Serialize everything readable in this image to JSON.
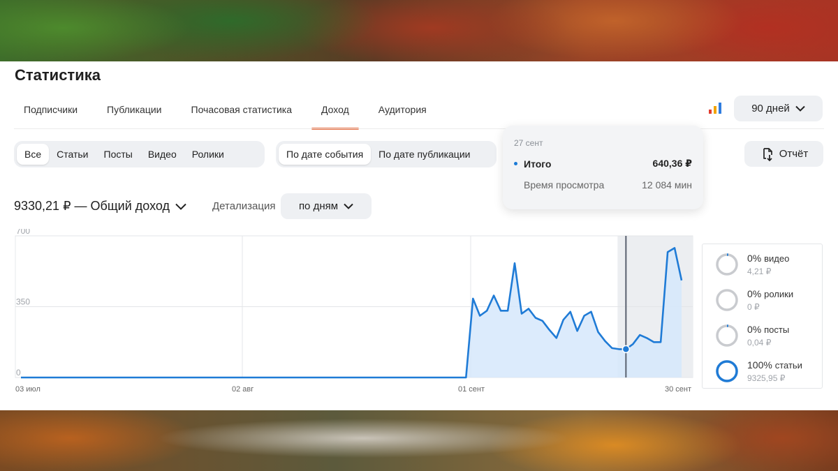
{
  "page": {
    "title": "Статистика"
  },
  "tabs": [
    {
      "label": "Подписчики",
      "active": false
    },
    {
      "label": "Публикации",
      "active": false
    },
    {
      "label": "Почасовая статистика",
      "active": false
    },
    {
      "label": "Доход",
      "active": true
    },
    {
      "label": "Аудитория",
      "active": false
    }
  ],
  "period": {
    "label": "90 дней"
  },
  "content_filter": [
    {
      "label": "Все",
      "active": true
    },
    {
      "label": "Статьи",
      "active": false
    },
    {
      "label": "Посты",
      "active": false
    },
    {
      "label": "Видео",
      "active": false
    },
    {
      "label": "Ролики",
      "active": false
    }
  ],
  "date_filter": [
    {
      "label": "По дате события",
      "active": true
    },
    {
      "label": "По дате публикации",
      "active": false
    }
  ],
  "report_button": {
    "label": "Отчёт"
  },
  "summary": {
    "total": "9330,21 ₽ — Общий доход"
  },
  "detail": {
    "label": "Детализация",
    "value": "по дням"
  },
  "tooltip": {
    "date": "27 сент",
    "total_label": "Итого",
    "total_value": "640,36 ₽",
    "view_label": "Время просмотра",
    "view_value": "12 084 мин"
  },
  "legend": [
    {
      "percent": "0%",
      "name": "видео",
      "amount": "4,21 ₽",
      "share": 0.02
    },
    {
      "percent": "0%",
      "name": "ролики",
      "amount": "0 ₽",
      "share": 0
    },
    {
      "percent": "0%",
      "name": "посты",
      "amount": "0,04 ₽",
      "share": 0.02
    },
    {
      "percent": "100%",
      "name": "статьи",
      "amount": "9325,95 ₽",
      "share": 1
    }
  ],
  "colors": {
    "accent": "#e86a3e",
    "line": "#1f7bd6",
    "fill": "#d6e8fb",
    "ring_gray": "#c9cbcf"
  },
  "icons": {
    "period_chevron": "chevron-down-icon",
    "report": "report-download-icon",
    "chart_type": "bar-chart-icon"
  },
  "chart_data": {
    "type": "area",
    "y_ticks": [
      "700",
      "350",
      "0"
    ],
    "ylim": [
      0,
      700
    ],
    "x_ticks": [
      "03 июл",
      "02 авг",
      "01 сент",
      "30 сент"
    ],
    "selected_day": 87,
    "values": [
      0,
      0,
      0,
      0,
      0,
      0,
      0,
      0,
      0,
      0,
      0,
      0,
      0,
      0,
      0,
      0,
      0,
      0,
      0,
      0,
      0,
      0,
      0,
      0,
      0,
      0,
      0,
      0,
      0,
      0,
      0,
      0,
      0,
      0,
      0,
      0,
      0,
      0,
      0,
      0,
      0,
      0,
      0,
      0,
      0,
      0,
      0,
      0,
      0,
      0,
      0,
      0,
      0,
      0,
      0,
      0,
      0,
      0,
      0,
      0,
      0,
      0,
      0,
      0,
      0,
      390,
      305,
      330,
      405,
      330,
      330,
      565,
      315,
      340,
      295,
      280,
      235,
      195,
      285,
      325,
      230,
      305,
      325,
      225,
      180,
      145,
      140,
      140,
      165,
      210,
      195,
      175,
      175,
      620,
      640,
      480
    ]
  }
}
